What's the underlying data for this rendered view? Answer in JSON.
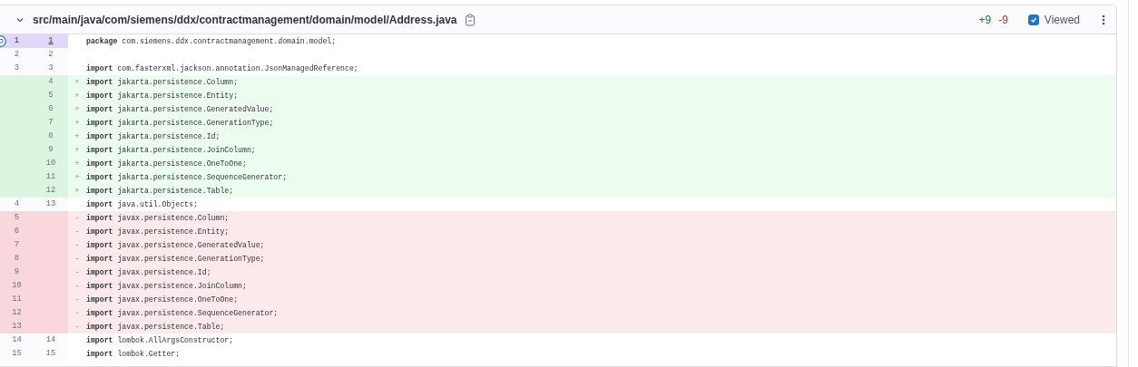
{
  "file": {
    "path": "src/main/java/com/siemens/ddx/contractmanagement/domain/model/Address.java",
    "expanded": true,
    "additions": "+9",
    "deletions": "-9",
    "viewed": {
      "label": "Viewed",
      "checked": true
    }
  },
  "lines": [
    {
      "kind": "context",
      "old": "1",
      "new": "1",
      "code": "**package** com.siemens.ddx.contractmanagement.domain.model;",
      "selected": true
    },
    {
      "kind": "context",
      "old": "2",
      "new": "2",
      "selected": false
    },
    {
      "kind": "context",
      "old": "3",
      "new": "3",
      "code": "**import** com.fasterxml.jackson.annotation.JsonManagedReference;",
      "selected": false
    },
    {
      "kind": "add",
      "new": "4",
      "sign": "+",
      "code": "**import** jakarta.persistence.Column;",
      "selected": false
    },
    {
      "kind": "add",
      "new": "5",
      "sign": "+",
      "code": "**import** jakarta.persistence.Entity;",
      "selected": false
    },
    {
      "kind": "add",
      "new": "6",
      "sign": "+",
      "code": "**import** jakarta.persistence.GeneratedValue;",
      "selected": false
    },
    {
      "kind": "add",
      "new": "7",
      "sign": "+",
      "code": "**import** jakarta.persistence.GenerationType;",
      "selected": false
    },
    {
      "kind": "add",
      "new": "8",
      "sign": "+",
      "code": "**import** jakarta.persistence.Id;",
      "selected": false
    },
    {
      "kind": "add",
      "new": "9",
      "sign": "+",
      "code": "**import** jakarta.persistence.JoinColumn;",
      "selected": false
    },
    {
      "kind": "add",
      "new": "10",
      "sign": "+",
      "code": "**import** jakarta.persistence.OneToOne;",
      "selected": false
    },
    {
      "kind": "add",
      "new": "11",
      "sign": "+",
      "code": "**import** jakarta.persistence.SequenceGenerator;",
      "selected": false
    },
    {
      "kind": "add",
      "new": "12",
      "sign": "+",
      "code": "**import** jakarta.persistence.Table;",
      "selected": false
    },
    {
      "kind": "context",
      "old": "4",
      "new": "13",
      "code": "**import** java.util.Objects;",
      "selected": false
    },
    {
      "kind": "del",
      "old": "5",
      "sign": "-",
      "code": "**import** javax.persistence.Column;",
      "selected": false
    },
    {
      "kind": "del",
      "old": "6",
      "sign": "-",
      "code": "**import** javax.persistence.Entity;",
      "selected": false
    },
    {
      "kind": "del",
      "old": "7",
      "sign": "-",
      "code": "**import** javax.persistence.GeneratedValue;",
      "selected": false
    },
    {
      "kind": "del",
      "old": "8",
      "sign": "-",
      "code": "**import** javax.persistence.GenerationType;",
      "selected": false
    },
    {
      "kind": "del",
      "old": "9",
      "sign": "-",
      "code": "**import** javax.persistence.Id;",
      "selected": false
    },
    {
      "kind": "del",
      "old": "10",
      "sign": "-",
      "code": "**import** javax.persistence.JoinColumn;",
      "selected": false
    },
    {
      "kind": "del",
      "old": "11",
      "sign": "-",
      "code": "**import** javax.persistence.OneToOne;",
      "selected": false
    },
    {
      "kind": "del",
      "old": "12",
      "sign": "-",
      "code": "**import** javax.persistence.SequenceGenerator;",
      "selected": false
    },
    {
      "kind": "del",
      "old": "13",
      "sign": "-",
      "code": "**import** javax.persistence.Table;",
      "selected": false
    },
    {
      "kind": "context",
      "old": "14",
      "new": "14",
      "code": "**import** lombok.AllArgsConstructor;",
      "selected": false
    },
    {
      "kind": "context",
      "old": "15",
      "new": "15",
      "code": "**import** lombok.Getter;",
      "selected": false
    }
  ]
}
